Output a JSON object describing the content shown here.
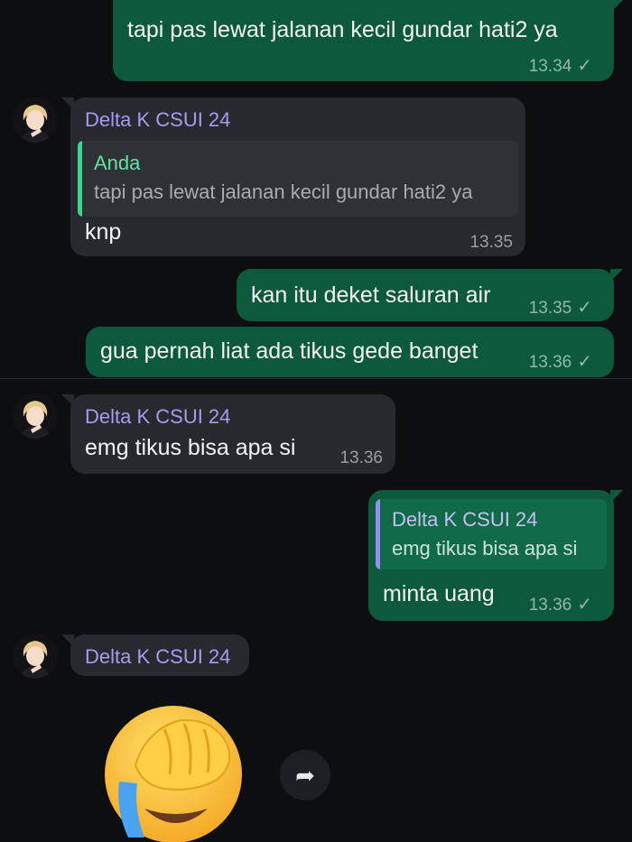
{
  "colors": {
    "background": "#0d0e10",
    "outgoing_bubble": "#0c5a3b",
    "incoming_bubble": "#26292d",
    "sender_name": "#a79bf0",
    "quote_self_accent": "#3dd58a",
    "quote_other_accent": "#9b8cf2"
  },
  "messages": [
    {
      "text": "tapi pas lewat jalanan kecil gundar hati2 ya",
      "time": "13.34",
      "status": "✓"
    },
    {
      "sender": "Delta K CSUI 24",
      "quote": {
        "name": "Anda",
        "text": "tapi pas lewat jalanan kecil gundar hati2 ya"
      },
      "text": "knp",
      "time": "13.35"
    },
    {
      "text": "kan itu deket saluran air",
      "time": "13.35",
      "status": "✓"
    },
    {
      "text": "gua pernah liat ada tikus gede banget",
      "time": "13.36",
      "status": "✓"
    },
    {
      "sender": "Delta K CSUI 24",
      "text": "emg tikus bisa apa si",
      "time": "13.36"
    },
    {
      "quote": {
        "name": "Delta K CSUI 24",
        "text": "emg tikus bisa apa si"
      },
      "text": "minta uang",
      "time": "13.36",
      "status": "✓"
    },
    {
      "sender": "Delta K CSUI 24",
      "sticker": "face-palm-crying-emoji"
    }
  ],
  "icons": {
    "avatar": "avatar-icon",
    "forward": "forward-icon",
    "read_check": "check-icon"
  }
}
